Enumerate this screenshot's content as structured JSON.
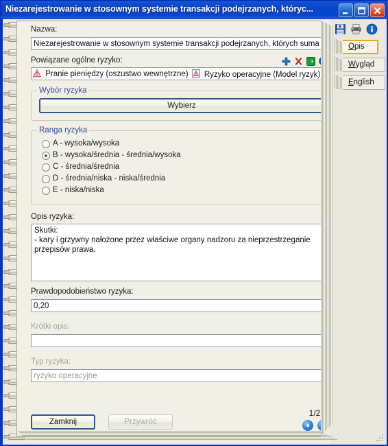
{
  "window": {
    "title": "Niezarejestrowanie w stosownym systemie transakcji podejrzanych, któryc...",
    "minimize_label": "Minimalizuj",
    "maximize_label": "Maksymalizuj",
    "close_label": "Zamknij okno",
    "accent_titlebar": "#0a45cd",
    "accent_close": "#c92d17",
    "paper_bg": "#f2f0e6"
  },
  "toolbar": {
    "icons": [
      {
        "name": "save-icon",
        "label": "Zapisz"
      },
      {
        "name": "print-icon",
        "label": "Drukuj"
      },
      {
        "name": "info-icon",
        "label": "Informacje"
      }
    ]
  },
  "tabs": [
    {
      "label": "Opis",
      "accesskey": "O",
      "active": true
    },
    {
      "label": "Wygląd",
      "accesskey": "W",
      "active": false
    },
    {
      "label": "English",
      "accesskey": "E",
      "active": false
    }
  ],
  "tabs_active_border": "#f0a513",
  "form": {
    "nazwa": {
      "label": "Nazwa:",
      "value": "Niezarejestrowanie w stosownym systemie transakcji podejrzanych, których suma przekroczy",
      "placeholder": ""
    },
    "powiazane": {
      "label": "Powiązane ogólne ryzyko:",
      "actions": [
        {
          "name": "add-icon",
          "label": "Dodaj",
          "color": "#1d6fd0"
        },
        {
          "name": "delete-icon",
          "label": "Usuń",
          "color": "#c4202a"
        },
        {
          "name": "goto-icon",
          "label": "Przejdź",
          "color": "#19a033"
        },
        {
          "name": "info-icon",
          "label": "Informacje",
          "color": "#1566c4"
        }
      ],
      "items": [
        {
          "icon": "warning-triangle-icon",
          "text": "Pranie pieniędzy (oszustwo wewnętrzne)"
        },
        {
          "icon": "warning-document-icon",
          "text": "Ryzyko operacyjne (Model ryzyk)"
        }
      ]
    },
    "wybor_ryzyka": {
      "legend": "Wybór ryzyka",
      "button_label": "Wybierz"
    },
    "ranga_ryzyka": {
      "legend": "Ranga ryzyka",
      "options": [
        {
          "value": "A",
          "label": "A - wysoka/wysoka",
          "selected": false
        },
        {
          "value": "B",
          "label": "B - wysoka/średnia - średnia/wysoka",
          "selected": true
        },
        {
          "value": "C",
          "label": "C - średnia/średnia",
          "selected": false
        },
        {
          "value": "D",
          "label": "D - średnia/niska - niska/średnia",
          "selected": false
        },
        {
          "value": "E",
          "label": "E - niska/niska",
          "selected": false
        }
      ]
    },
    "opis_ryzyka": {
      "label": "Opis ryzyka:",
      "expand_button_name": "expand-description-button",
      "value": "Skutki:\n- kary i grzywny nałożone przez właściwe organy nadzoru za nieprzestrzeganie\nprzepisów prawa."
    },
    "prawdopodobienstwo": {
      "label": "Prawdopodobieństwo ryzyka:",
      "value": "0,20"
    },
    "krotki_opis": {
      "label": "Krótki opis:",
      "value": ""
    },
    "typ_ryzyka": {
      "label": "Typ ryzyka:",
      "value": "ryzyko operacyjne"
    }
  },
  "footer": {
    "close_button": "Zamknij",
    "restore_button": "Przywróć",
    "restore_disabled": true,
    "page_indicator": "1/2",
    "prev_label": "Poprzednia",
    "next_label": "Następna"
  }
}
